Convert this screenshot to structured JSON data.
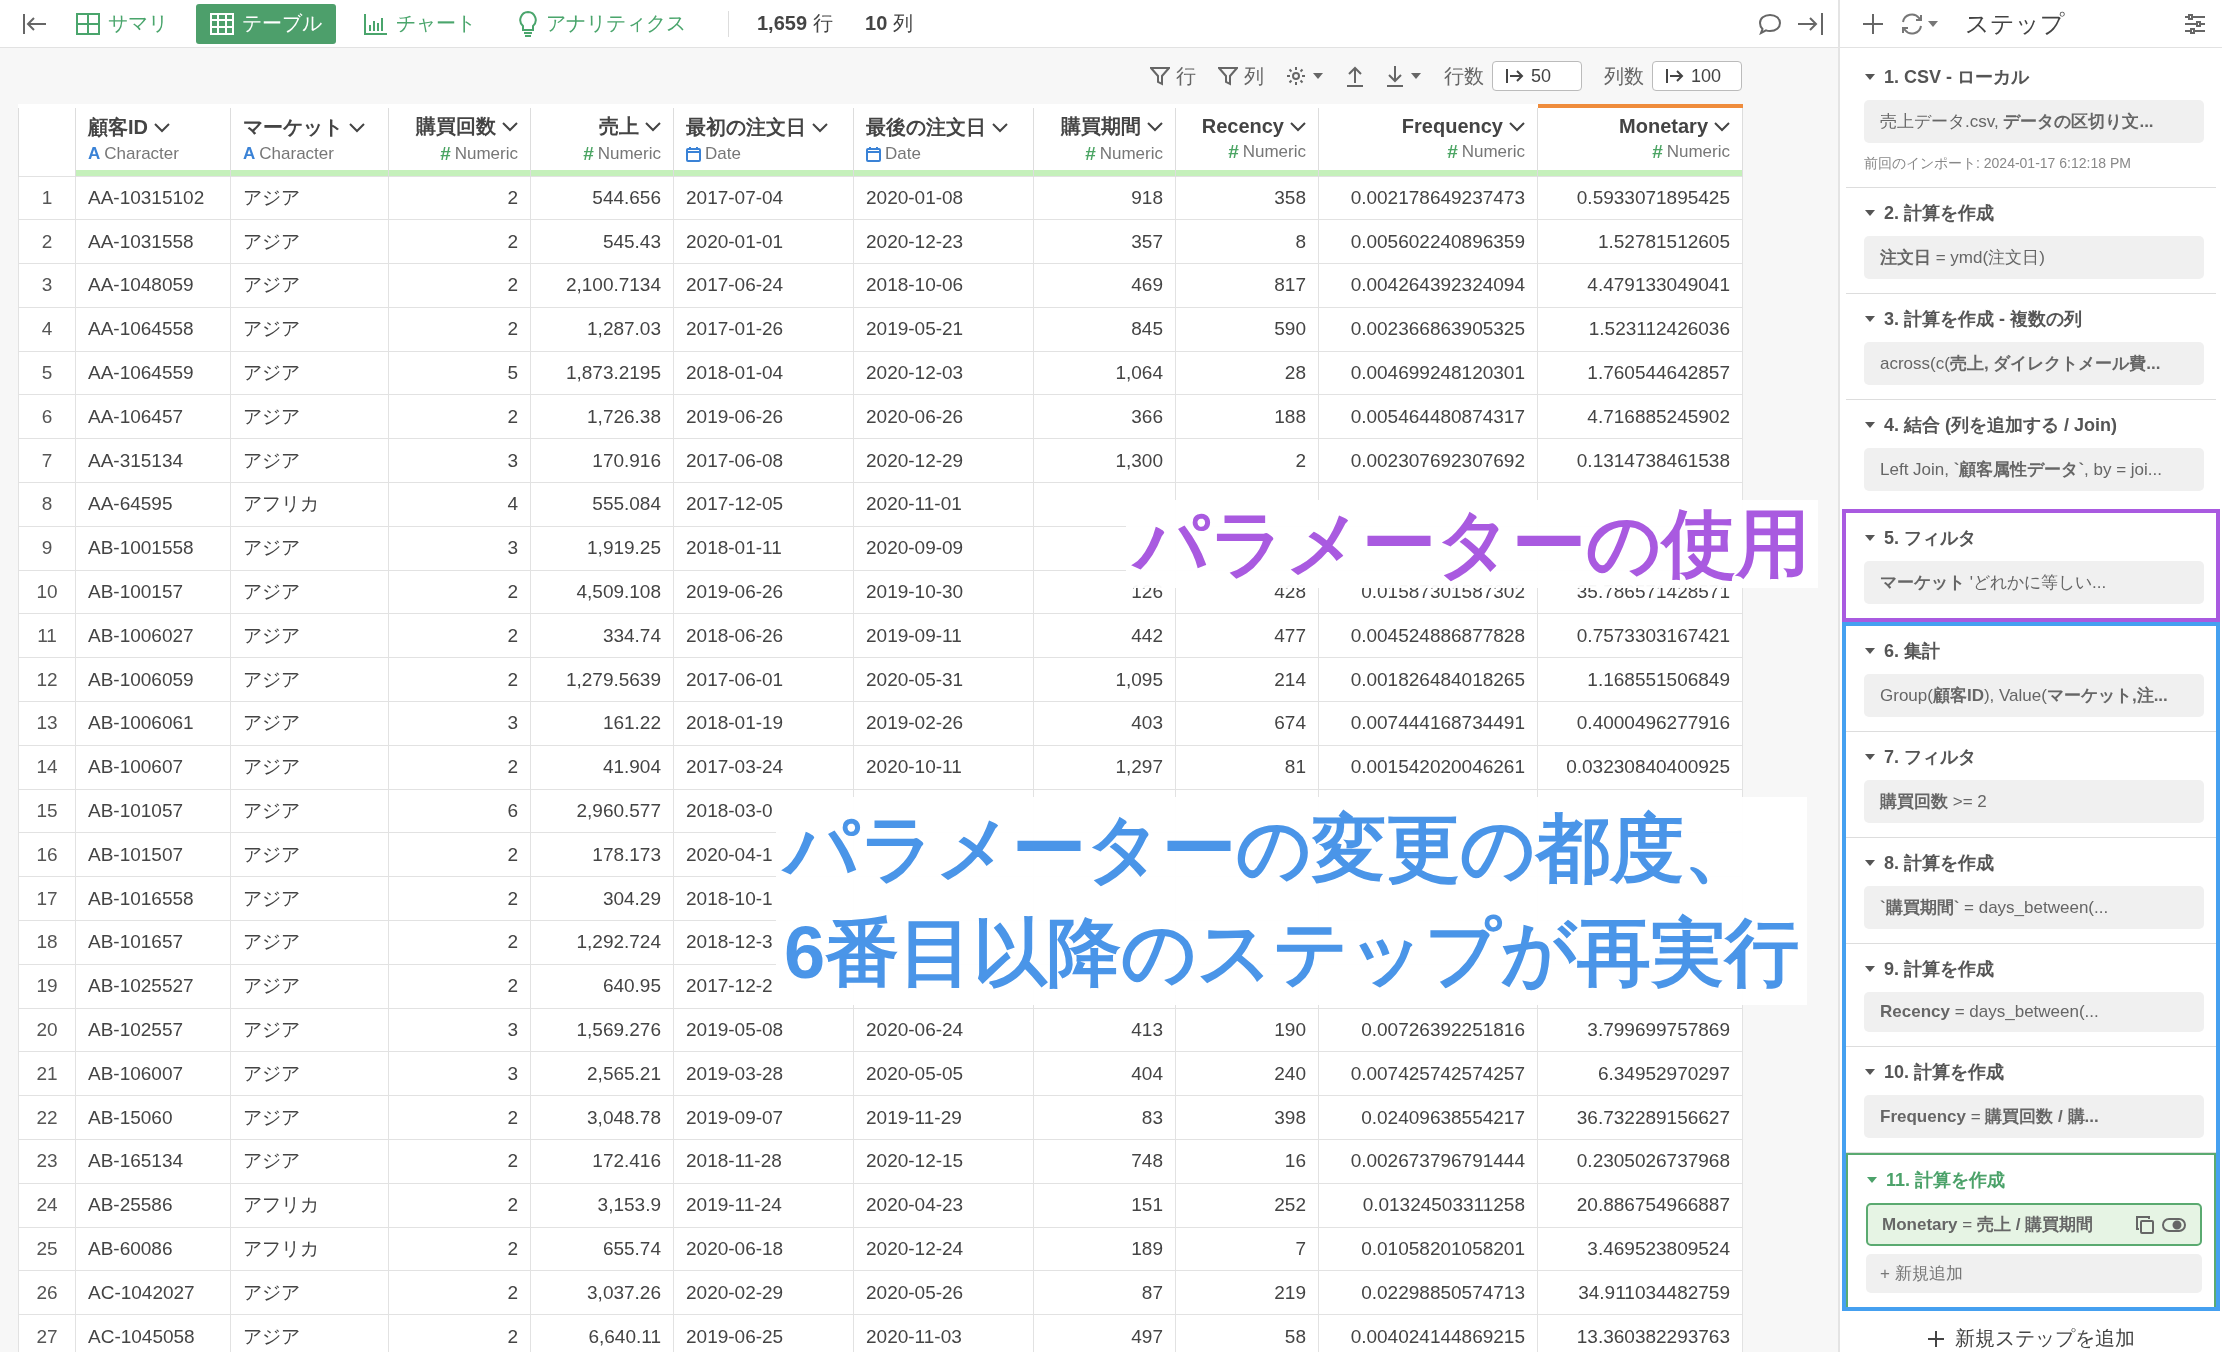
{
  "topbar": {
    "tabs": [
      {
        "label": "サマリ",
        "selected": false
      },
      {
        "label": "テーブル",
        "selected": true
      },
      {
        "label": "チャート",
        "selected": false
      },
      {
        "label": "アナリティクス",
        "selected": false
      }
    ],
    "row_count": {
      "value": "1,659",
      "unit": "行"
    },
    "column_count": {
      "value": "10",
      "unit": "列"
    }
  },
  "toolbar": {
    "row_filter": "行",
    "column_filter": "列",
    "rows_label": "行数",
    "rows_value": "50",
    "columns_label": "列数",
    "columns_value": "100"
  },
  "table": {
    "columns": [
      {
        "name": "顧客ID",
        "type": "Character",
        "type_mark": "A",
        "selected": false
      },
      {
        "name": "マーケット",
        "type": "Character",
        "type_mark": "A",
        "selected": false
      },
      {
        "name": "購買回数",
        "type": "Numeric",
        "type_mark": "#",
        "selected": false
      },
      {
        "name": "売上",
        "type": "Numeric",
        "type_mark": "#",
        "selected": false
      },
      {
        "name": "最初の注文日",
        "type": "Date",
        "selected": false
      },
      {
        "name": "最後の注文日",
        "type": "Date",
        "selected": false
      },
      {
        "name": "購買期間",
        "type": "Numeric",
        "type_mark": "#",
        "selected": false
      },
      {
        "name": "Recency",
        "type": "Numeric",
        "type_mark": "#",
        "selected": false
      },
      {
        "name": "Frequency",
        "type": "Numeric",
        "type_mark": "#",
        "selected": false
      },
      {
        "name": "Monetary",
        "type": "Numeric",
        "type_mark": "#",
        "selected": true
      }
    ],
    "rows": [
      {
        "number": "1",
        "cells": [
          "AA-10315102",
          "アジア",
          "2",
          "544.656",
          "2017-07-04",
          "2020-01-08",
          "918",
          "358",
          "0.002178649237473",
          "0.5933071895425"
        ]
      },
      {
        "number": "2",
        "cells": [
          "AA-1031558",
          "アジア",
          "2",
          "545.43",
          "2020-01-01",
          "2020-12-23",
          "357",
          "8",
          "0.005602240896359",
          "1.52781512605"
        ]
      },
      {
        "number": "3",
        "cells": [
          "AA-1048059",
          "アジア",
          "2",
          "2,100.7134",
          "2017-06-24",
          "2018-10-06",
          "469",
          "817",
          "0.004264392324094",
          "4.479133049041"
        ]
      },
      {
        "number": "4",
        "cells": [
          "AA-1064558",
          "アジア",
          "2",
          "1,287.03",
          "2017-01-26",
          "2019-05-21",
          "845",
          "590",
          "0.002366863905325",
          "1.523112426036"
        ]
      },
      {
        "number": "5",
        "cells": [
          "AA-1064559",
          "アジア",
          "5",
          "1,873.2195",
          "2018-01-04",
          "2020-12-03",
          "1,064",
          "28",
          "0.004699248120301",
          "1.760544642857"
        ]
      },
      {
        "number": "6",
        "cells": [
          "AA-106457",
          "アジア",
          "2",
          "1,726.38",
          "2019-06-26",
          "2020-06-26",
          "366",
          "188",
          "0.005464480874317",
          "4.716885245902"
        ]
      },
      {
        "number": "7",
        "cells": [
          "AA-315134",
          "アジア",
          "3",
          "170.916",
          "2017-06-08",
          "2020-12-29",
          "1,300",
          "2",
          "0.002307692307692",
          "0.1314738461538"
        ]
      },
      {
        "number": "8",
        "cells": [
          "AA-64595",
          "アフリカ",
          "4",
          "555.084",
          "2017-12-05",
          "2020-11-01",
          null,
          null,
          null,
          null
        ]
      },
      {
        "number": "9",
        "cells": [
          "AB-1001558",
          "アジア",
          "3",
          "1,919.25",
          "2018-01-11",
          "2020-09-09",
          null,
          null,
          null,
          null
        ]
      },
      {
        "number": "10",
        "cells": [
          "AB-100157",
          "アジア",
          "2",
          "4,509.108",
          "2019-06-26",
          "2019-10-30",
          "126",
          "428",
          "0.01587301587302",
          "35.786571428571"
        ]
      },
      {
        "number": "11",
        "cells": [
          "AB-1006027",
          "アジア",
          "2",
          "334.74",
          "2018-06-26",
          "2019-09-11",
          "442",
          "477",
          "0.004524886877828",
          "0.7573303167421"
        ]
      },
      {
        "number": "12",
        "cells": [
          "AB-1006059",
          "アジア",
          "2",
          "1,279.5639",
          "2017-06-01",
          "2020-05-31",
          "1,095",
          "214",
          "0.001826484018265",
          "1.168551506849"
        ]
      },
      {
        "number": "13",
        "cells": [
          "AB-1006061",
          "アジア",
          "3",
          "161.22",
          "2018-01-19",
          "2019-02-26",
          "403",
          "674",
          "0.007444168734491",
          "0.4000496277916"
        ]
      },
      {
        "number": "14",
        "cells": [
          "AB-100607",
          "アジア",
          "2",
          "41.904",
          "2017-03-24",
          "2020-10-11",
          "1,297",
          "81",
          "0.001542020046261",
          "0.03230840400925"
        ]
      },
      {
        "number": "15",
        "cells": [
          "AB-101057",
          "アジア",
          "6",
          "2,960.577",
          "2018-03-0",
          null,
          null,
          null,
          null,
          null
        ]
      },
      {
        "number": "16",
        "cells": [
          "AB-101507",
          "アジア",
          "2",
          "178.173",
          "2020-04-1",
          null,
          null,
          null,
          null,
          null
        ]
      },
      {
        "number": "17",
        "cells": [
          "AB-1016558",
          "アジア",
          "2",
          "304.29",
          "2018-10-1",
          null,
          null,
          null,
          null,
          null
        ]
      },
      {
        "number": "18",
        "cells": [
          "AB-101657",
          "アジア",
          "2",
          "1,292.724",
          "2018-12-3",
          null,
          null,
          null,
          null,
          null
        ]
      },
      {
        "number": "19",
        "cells": [
          "AB-1025527",
          "アジア",
          "2",
          "640.95",
          "2017-12-2",
          null,
          null,
          null,
          null,
          null
        ]
      },
      {
        "number": "20",
        "cells": [
          "AB-102557",
          "アジア",
          "3",
          "1,569.276",
          "2019-05-08",
          "2020-06-24",
          "413",
          "190",
          "0.00726392251816",
          "3.799699757869"
        ]
      },
      {
        "number": "21",
        "cells": [
          "AB-106007",
          "アジア",
          "3",
          "2,565.21",
          "2019-03-28",
          "2020-05-05",
          "404",
          "240",
          "0.007425742574257",
          "6.34952970297"
        ]
      },
      {
        "number": "22",
        "cells": [
          "AB-15060",
          "アジア",
          "2",
          "3,048.78",
          "2019-09-07",
          "2019-11-29",
          "83",
          "398",
          "0.02409638554217",
          "36.732289156627"
        ]
      },
      {
        "number": "23",
        "cells": [
          "AB-165134",
          "アジア",
          "2",
          "172.416",
          "2018-11-28",
          "2020-12-15",
          "748",
          "16",
          "0.002673796791444",
          "0.2305026737968"
        ]
      },
      {
        "number": "24",
        "cells": [
          "AB-25586",
          "アフリカ",
          "2",
          "3,153.9",
          "2019-11-24",
          "2020-04-23",
          "151",
          "252",
          "0.01324503311258",
          "20.886754966887"
        ]
      },
      {
        "number": "25",
        "cells": [
          "AB-60086",
          "アフリカ",
          "2",
          "655.74",
          "2020-06-18",
          "2020-12-24",
          "189",
          "7",
          "0.01058201058201",
          "3.469523809524"
        ]
      },
      {
        "number": "26",
        "cells": [
          "AC-1042027",
          "アジア",
          "2",
          "3,037.26",
          "2020-02-29",
          "2020-05-26",
          "87",
          "219",
          "0.02298850574713",
          "34.911034482759"
        ]
      },
      {
        "number": "27",
        "cells": [
          "AC-1045058",
          "アジア",
          "2",
          "6,640.11",
          "2019-06-25",
          "2020-11-03",
          "497",
          "58",
          "0.004024144869215",
          "13.360382293763"
        ]
      }
    ]
  },
  "callouts": [
    {
      "lines": [
        "パラメーターの使用"
      ],
      "color": "#a95ae0"
    },
    {
      "lines": [
        "パラメーターの変更の都度、",
        "6番目以降のステップが再実行"
      ],
      "color": "#4a95e8"
    }
  ],
  "steps_panel": {
    "title": "ステップ",
    "groups": [
      {
        "steps": [
          {
            "title": "1. CSV - ローカル",
            "expression": "売上データ.csv, **データの区切り文...**",
            "note": "前回のインポート: 2024-01-17 6:12:18 PM",
            "selected": false
          },
          {
            "title": "2. 計算を作成",
            "expression": "**注文日** = ymd(注文日)",
            "selected": false
          },
          {
            "title": "3. 計算を作成 - 複数の列",
            "expression": "across(c(**売上, ダイレクトメール費...**",
            "selected": false
          },
          {
            "title": "4. 結合 (列を追加する / Join)",
            "expression": "Left Join, **`顧客属性データ`**, by = joi...",
            "selected": false
          }
        ]
      },
      {
        "color": "#a95ae0",
        "steps": [
          {
            "title": "5. フィルタ",
            "expression": "**マーケット** 'どれかに等しい...",
            "selected": false
          }
        ]
      },
      {
        "color": "#45a0f0",
        "steps": [
          {
            "title": "6. 集計",
            "expression": "Group(**顧客ID**), Value(**マーケット,注...**",
            "selected": false
          },
          {
            "title": "7. フィルタ",
            "expression": "**購買回数** >= 2",
            "selected": false
          },
          {
            "title": "8. 計算を作成",
            "expression": "**`購買期間`** = days_between(...",
            "selected": false
          },
          {
            "title": "9. 計算を作成",
            "expression": "**Recency** = days_between(...",
            "selected": false
          },
          {
            "title": "10. 計算を作成",
            "expression": "**Frequency** = **購買回数 / 購...**",
            "selected": false
          },
          {
            "title": "11. 計算を作成",
            "expression": "**Monetary** = **売上 / 購買期間**",
            "selected": true,
            "add_label": "+ 新規追加"
          }
        ]
      }
    ],
    "add_step": "新規ステップを追加"
  }
}
